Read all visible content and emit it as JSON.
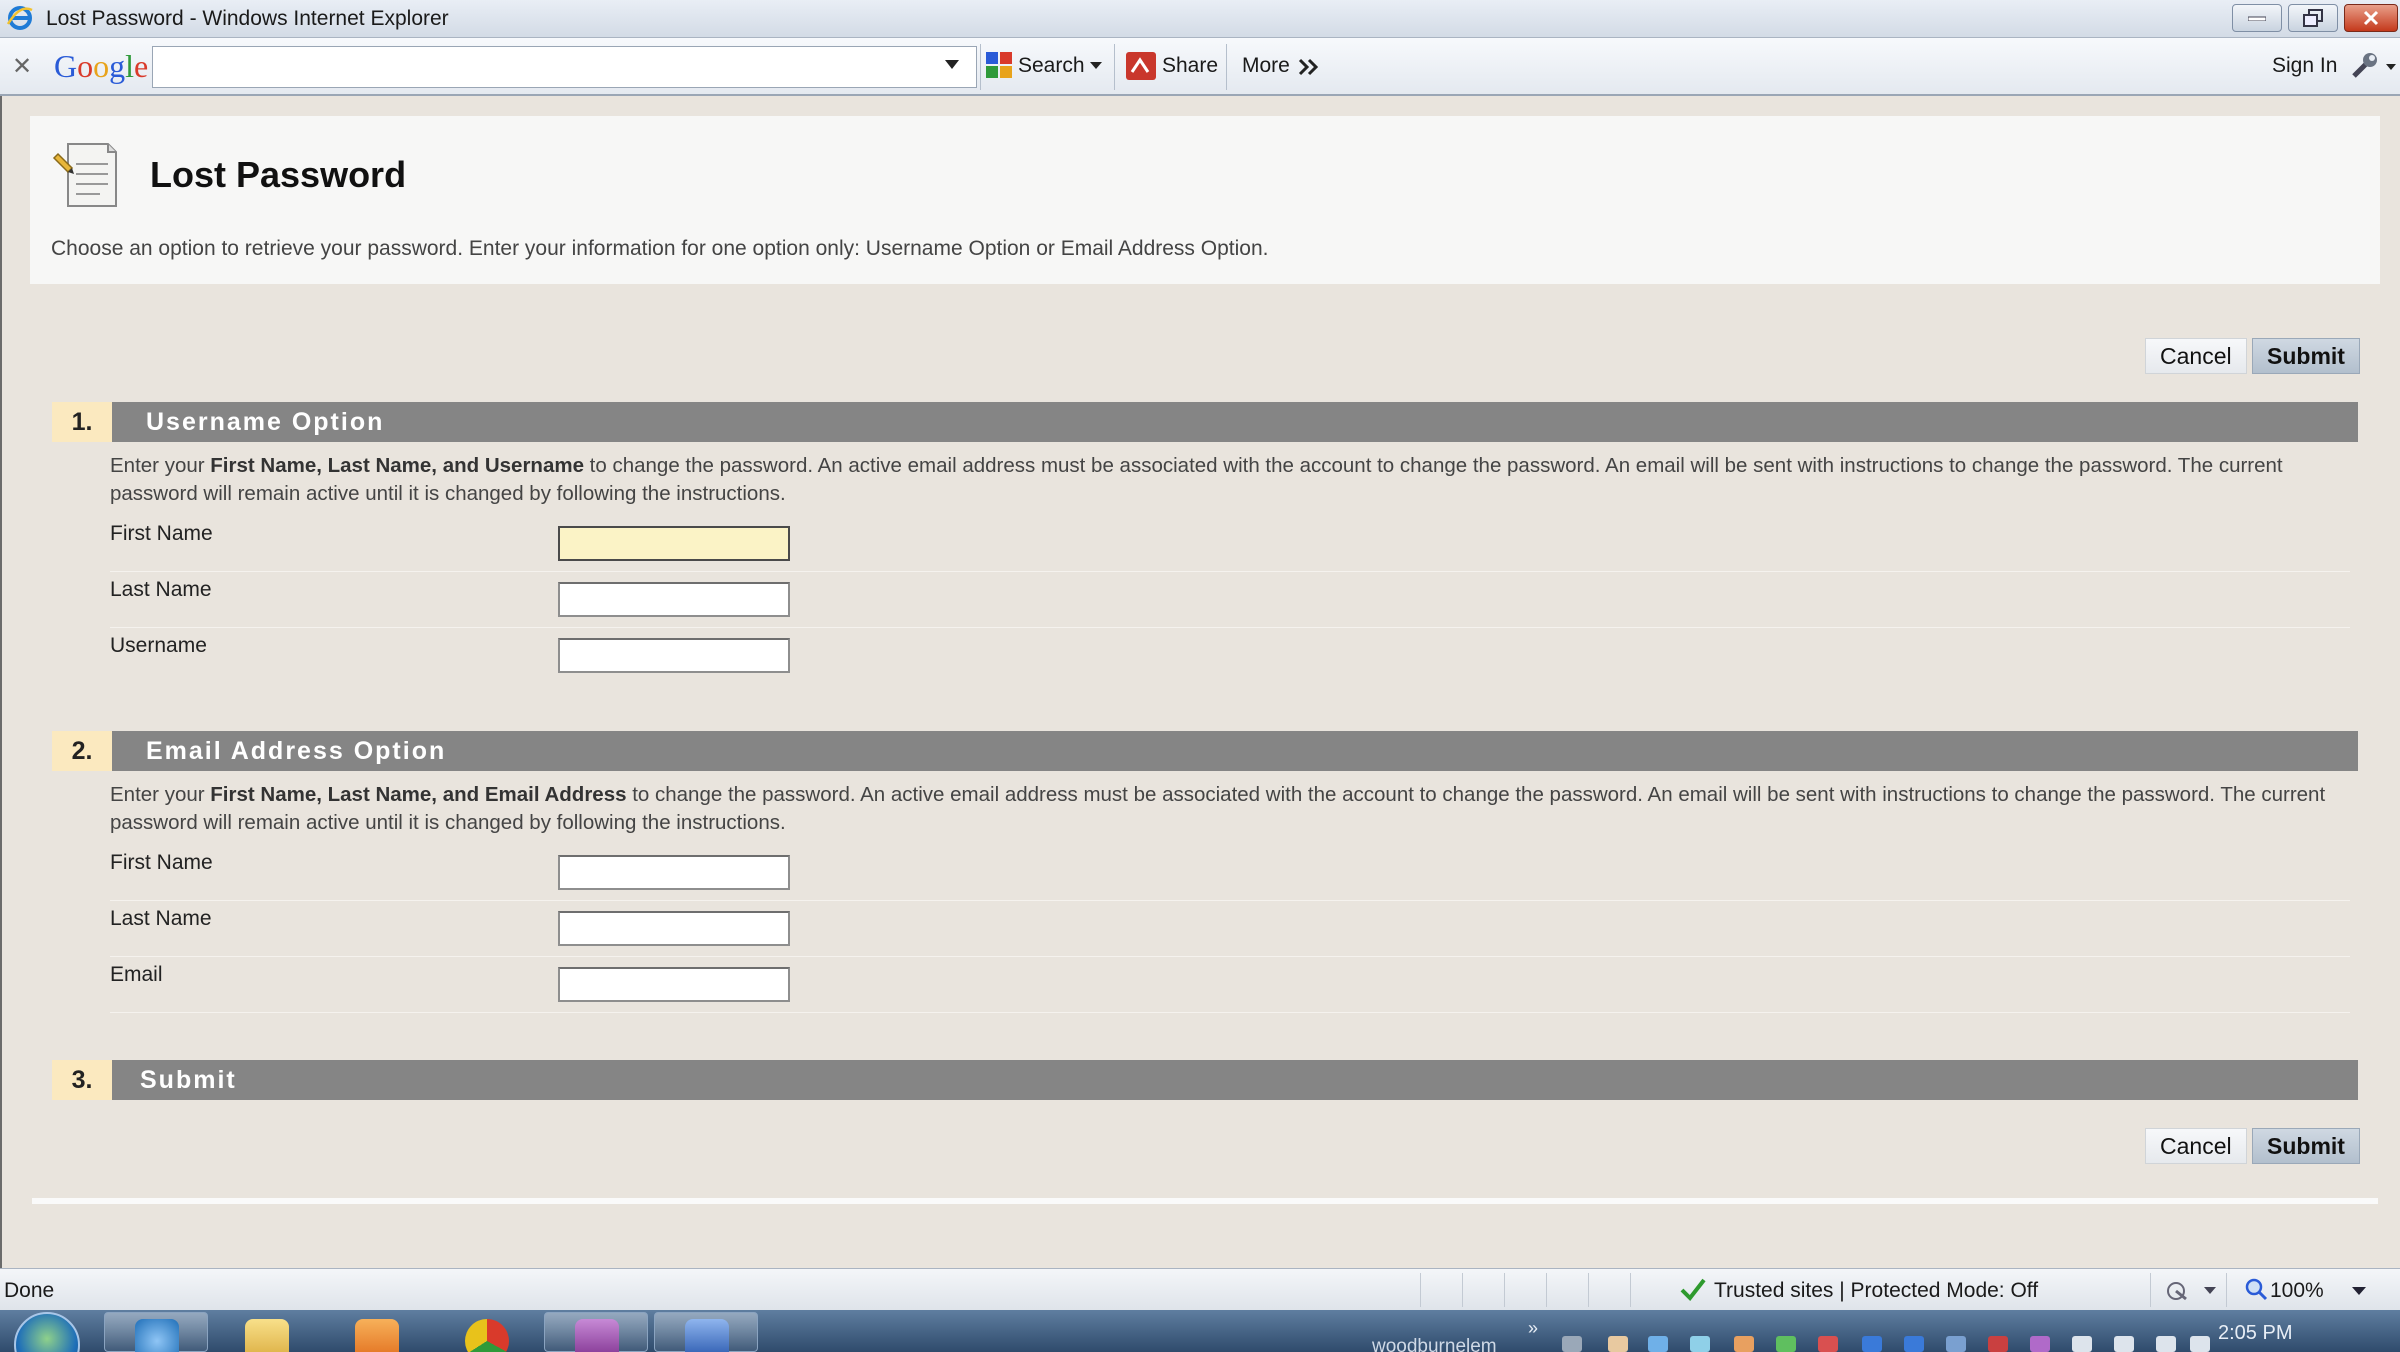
{
  "window": {
    "title": "Lost Password - Windows Internet Explorer"
  },
  "google_toolbar": {
    "logo": "Google",
    "search_value": "",
    "search_label": "Search",
    "share_label": "Share",
    "more_label": "More",
    "sign_in_label": "Sign In"
  },
  "page": {
    "title": "Lost Password",
    "description": "Choose an option to retrieve your password. Enter your information for one option only: Username Option or Email Address Option.",
    "cancel_label": "Cancel",
    "submit_label": "Submit"
  },
  "sections": [
    {
      "number": "1.",
      "title": "Username Option",
      "desc_prefix": "Enter your ",
      "desc_bold": "First Name, Last Name, and Username",
      "desc_rest": " to change the password. An active email address must be associated with the account to change the password. An email will be sent with instructions to change the password. The current password will remain active until it is changed by following the instructions.",
      "fields": [
        {
          "label": "First Name",
          "value": ""
        },
        {
          "label": "Last Name",
          "value": ""
        },
        {
          "label": "Username",
          "value": ""
        }
      ]
    },
    {
      "number": "2.",
      "title": "Email Address Option",
      "desc_prefix": "Enter your ",
      "desc_bold": "First Name, Last Name, and Email Address",
      "desc_rest": " to change the password. An active email address must be associated with the account to change the password. An email will be sent with instructions to change the password. The current password will remain active until it is changed by following the instructions.",
      "fields": [
        {
          "label": "First Name",
          "value": ""
        },
        {
          "label": "Last Name",
          "value": ""
        },
        {
          "label": "Email",
          "value": ""
        }
      ]
    },
    {
      "number": "3.",
      "title": "Submit"
    }
  ],
  "status_bar": {
    "status": "Done",
    "zone": "Trusted sites | Protected Mode: Off",
    "zoom": "100%"
  },
  "taskbar": {
    "user": "woodburnelem",
    "clock": "2:05 PM"
  },
  "colors": {
    "section_bar": "#858585",
    "section_number_bg": "#fbe9bf",
    "focused_input_bg": "#fbf3c6",
    "page_bg": "#e9e4dd"
  }
}
